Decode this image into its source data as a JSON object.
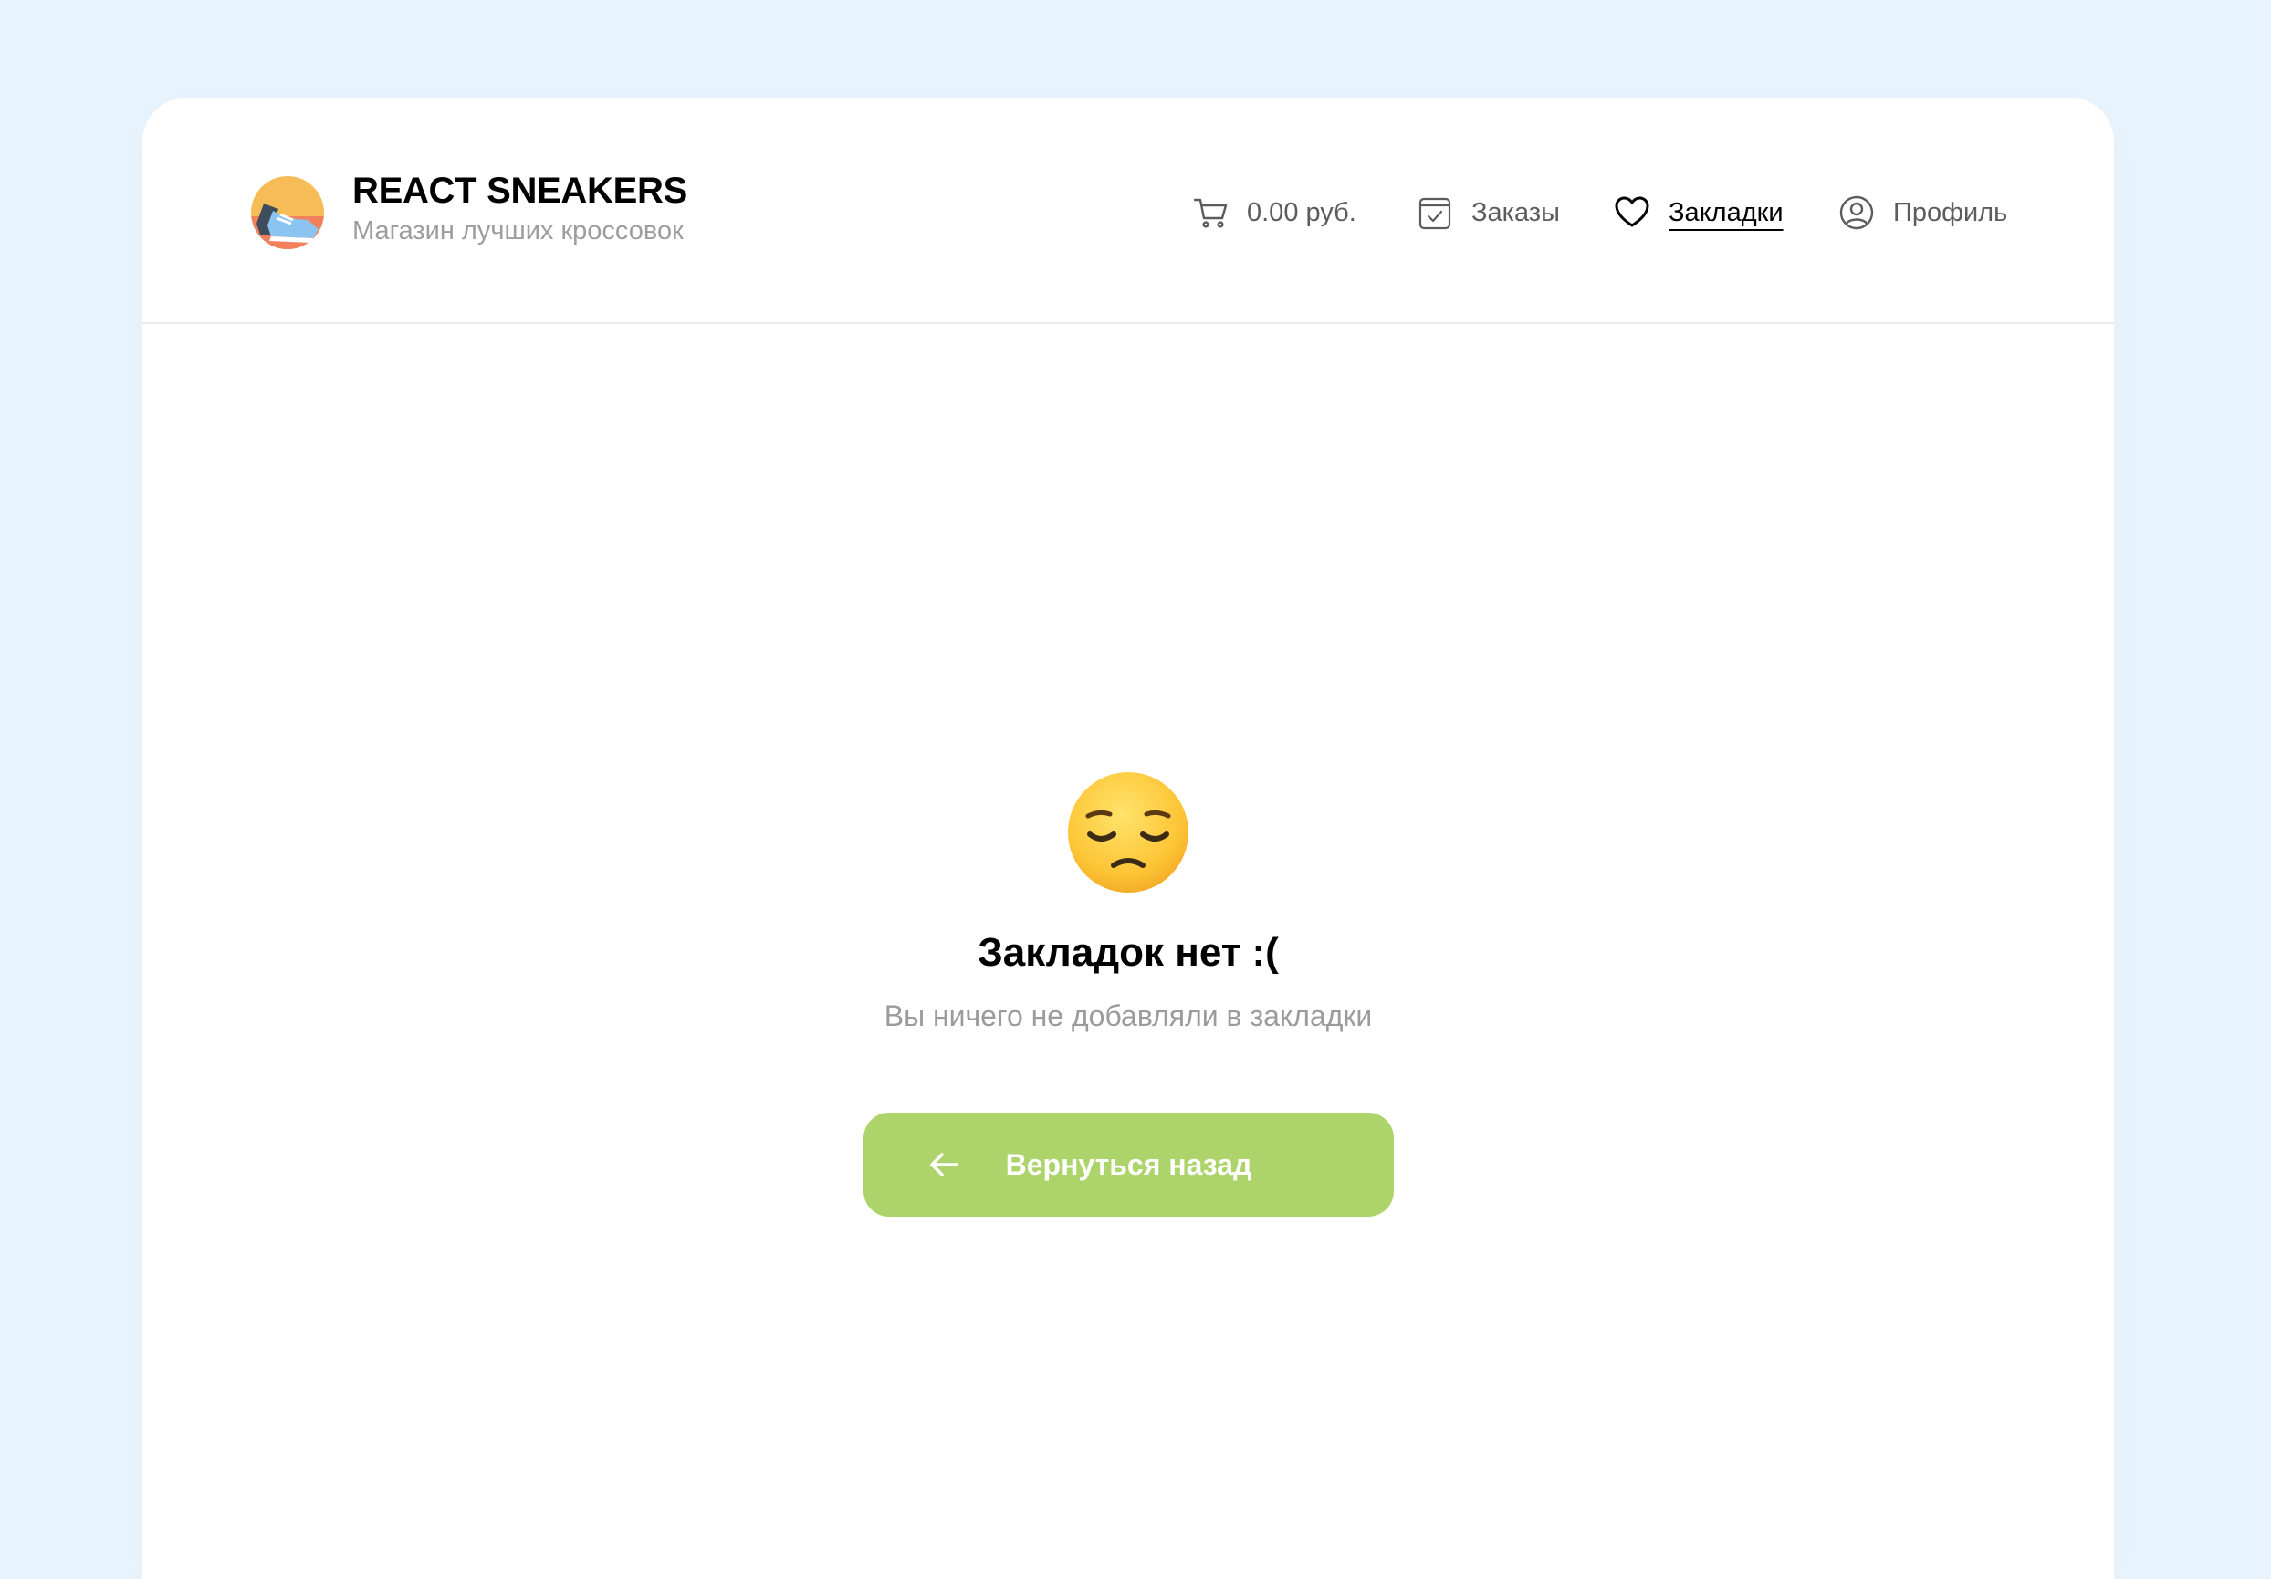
{
  "brand": {
    "title": "REACT SNEAKERS",
    "subtitle": "Магазин лучших кроссовок"
  },
  "nav": {
    "cart": {
      "label": "0.00 руб.",
      "icon": "cart-icon"
    },
    "orders": {
      "label": "Заказы",
      "icon": "orders-icon"
    },
    "bookmarks": {
      "label": "Закладки",
      "icon": "heart-icon",
      "active": true
    },
    "profile": {
      "label": "Профиль",
      "icon": "user-icon"
    }
  },
  "empty_state": {
    "icon": "pensive-face-emoji",
    "title": "Закладок нет :(",
    "subtitle": "Вы ничего не добавляли в закладки",
    "button_label": "Вернуться назад",
    "button_icon": "arrow-left-icon"
  },
  "colors": {
    "page_background": "#E7F3FD",
    "card_background": "#FFFFFF",
    "accent_button": "#ACD46B",
    "muted_text": "#9D9D9D"
  }
}
